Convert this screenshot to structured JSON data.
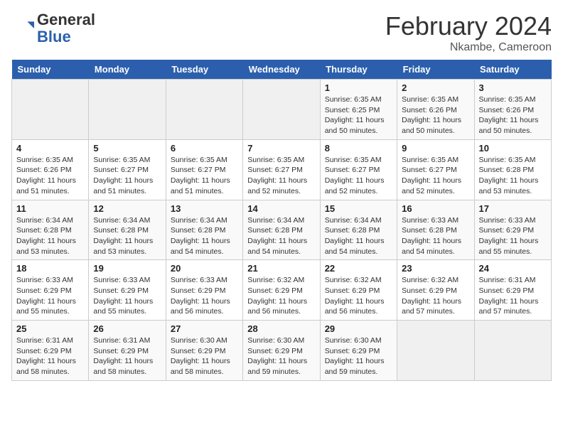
{
  "header": {
    "logo": {
      "general": "General",
      "blue": "Blue"
    },
    "title": "February 2024",
    "subtitle": "Nkambe, Cameroon"
  },
  "columns": [
    "Sunday",
    "Monday",
    "Tuesday",
    "Wednesday",
    "Thursday",
    "Friday",
    "Saturday"
  ],
  "weeks": [
    [
      {
        "day": "",
        "info": ""
      },
      {
        "day": "",
        "info": ""
      },
      {
        "day": "",
        "info": ""
      },
      {
        "day": "",
        "info": ""
      },
      {
        "day": "1",
        "info": "Sunrise: 6:35 AM\nSunset: 6:25 PM\nDaylight: 11 hours and 50 minutes."
      },
      {
        "day": "2",
        "info": "Sunrise: 6:35 AM\nSunset: 6:26 PM\nDaylight: 11 hours and 50 minutes."
      },
      {
        "day": "3",
        "info": "Sunrise: 6:35 AM\nSunset: 6:26 PM\nDaylight: 11 hours and 50 minutes."
      }
    ],
    [
      {
        "day": "4",
        "info": "Sunrise: 6:35 AM\nSunset: 6:26 PM\nDaylight: 11 hours and 51 minutes."
      },
      {
        "day": "5",
        "info": "Sunrise: 6:35 AM\nSunset: 6:27 PM\nDaylight: 11 hours and 51 minutes."
      },
      {
        "day": "6",
        "info": "Sunrise: 6:35 AM\nSunset: 6:27 PM\nDaylight: 11 hours and 51 minutes."
      },
      {
        "day": "7",
        "info": "Sunrise: 6:35 AM\nSunset: 6:27 PM\nDaylight: 11 hours and 52 minutes."
      },
      {
        "day": "8",
        "info": "Sunrise: 6:35 AM\nSunset: 6:27 PM\nDaylight: 11 hours and 52 minutes."
      },
      {
        "day": "9",
        "info": "Sunrise: 6:35 AM\nSunset: 6:27 PM\nDaylight: 11 hours and 52 minutes."
      },
      {
        "day": "10",
        "info": "Sunrise: 6:35 AM\nSunset: 6:28 PM\nDaylight: 11 hours and 53 minutes."
      }
    ],
    [
      {
        "day": "11",
        "info": "Sunrise: 6:34 AM\nSunset: 6:28 PM\nDaylight: 11 hours and 53 minutes."
      },
      {
        "day": "12",
        "info": "Sunrise: 6:34 AM\nSunset: 6:28 PM\nDaylight: 11 hours and 53 minutes."
      },
      {
        "day": "13",
        "info": "Sunrise: 6:34 AM\nSunset: 6:28 PM\nDaylight: 11 hours and 54 minutes."
      },
      {
        "day": "14",
        "info": "Sunrise: 6:34 AM\nSunset: 6:28 PM\nDaylight: 11 hours and 54 minutes."
      },
      {
        "day": "15",
        "info": "Sunrise: 6:34 AM\nSunset: 6:28 PM\nDaylight: 11 hours and 54 minutes."
      },
      {
        "day": "16",
        "info": "Sunrise: 6:33 AM\nSunset: 6:28 PM\nDaylight: 11 hours and 54 minutes."
      },
      {
        "day": "17",
        "info": "Sunrise: 6:33 AM\nSunset: 6:29 PM\nDaylight: 11 hours and 55 minutes."
      }
    ],
    [
      {
        "day": "18",
        "info": "Sunrise: 6:33 AM\nSunset: 6:29 PM\nDaylight: 11 hours and 55 minutes."
      },
      {
        "day": "19",
        "info": "Sunrise: 6:33 AM\nSunset: 6:29 PM\nDaylight: 11 hours and 55 minutes."
      },
      {
        "day": "20",
        "info": "Sunrise: 6:33 AM\nSunset: 6:29 PM\nDaylight: 11 hours and 56 minutes."
      },
      {
        "day": "21",
        "info": "Sunrise: 6:32 AM\nSunset: 6:29 PM\nDaylight: 11 hours and 56 minutes."
      },
      {
        "day": "22",
        "info": "Sunrise: 6:32 AM\nSunset: 6:29 PM\nDaylight: 11 hours and 56 minutes."
      },
      {
        "day": "23",
        "info": "Sunrise: 6:32 AM\nSunset: 6:29 PM\nDaylight: 11 hours and 57 minutes."
      },
      {
        "day": "24",
        "info": "Sunrise: 6:31 AM\nSunset: 6:29 PM\nDaylight: 11 hours and 57 minutes."
      }
    ],
    [
      {
        "day": "25",
        "info": "Sunrise: 6:31 AM\nSunset: 6:29 PM\nDaylight: 11 hours and 58 minutes."
      },
      {
        "day": "26",
        "info": "Sunrise: 6:31 AM\nSunset: 6:29 PM\nDaylight: 11 hours and 58 minutes."
      },
      {
        "day": "27",
        "info": "Sunrise: 6:30 AM\nSunset: 6:29 PM\nDaylight: 11 hours and 58 minutes."
      },
      {
        "day": "28",
        "info": "Sunrise: 6:30 AM\nSunset: 6:29 PM\nDaylight: 11 hours and 59 minutes."
      },
      {
        "day": "29",
        "info": "Sunrise: 6:30 AM\nSunset: 6:29 PM\nDaylight: 11 hours and 59 minutes."
      },
      {
        "day": "",
        "info": ""
      },
      {
        "day": "",
        "info": ""
      }
    ]
  ]
}
